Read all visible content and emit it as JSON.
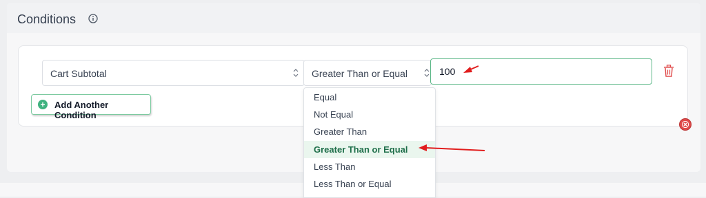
{
  "header": {
    "title": "Conditions",
    "info_icon": "info-circle-icon"
  },
  "condition_row": {
    "field_select": {
      "value": "Cart Subtotal"
    },
    "operator_select": {
      "value": "Greater Than or Equal"
    },
    "value_input": {
      "value": "100"
    },
    "delete_icon": "trash-icon"
  },
  "add_condition": {
    "label": "Add Another Condition",
    "icon": "plus-circle-icon"
  },
  "operator_dropdown": {
    "options": [
      "Equal",
      "Not Equal",
      "Greater Than",
      "Greater Than or Equal",
      "Less Than",
      "Less Than or Equal"
    ],
    "selected_index": 3
  },
  "colors": {
    "accent_green": "#3fb27f",
    "selected_bg": "#eaf6ee",
    "delete_red": "#e04b4b",
    "annotation_arrow": "#e11d1d"
  }
}
